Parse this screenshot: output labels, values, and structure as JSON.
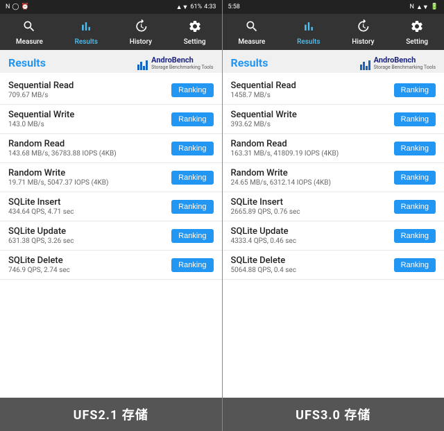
{
  "left_phone": {
    "status_bar": {
      "left": "N  ◯  ⏰",
      "signal": "▲▼",
      "battery": "61%",
      "time": "4:33"
    },
    "nav": {
      "items": [
        {
          "id": "measure",
          "label": "Measure",
          "icon": "search"
        },
        {
          "id": "results",
          "label": "Results",
          "icon": "chart",
          "active": true
        },
        {
          "id": "history",
          "label": "History",
          "icon": "history"
        },
        {
          "id": "setting",
          "label": "Setting",
          "icon": "settings"
        }
      ]
    },
    "results_title": "Results",
    "brand_name": "AndroBench",
    "brand_sub": "Storage Benchmarking Tools",
    "benchmarks": [
      {
        "name": "Sequential Read",
        "value": "709.67 MB/s"
      },
      {
        "name": "Sequential Write",
        "value": "143.0 MB/s"
      },
      {
        "name": "Random Read",
        "value": "143.68 MB/s, 36783.88 IOPS (4KB)"
      },
      {
        "name": "Random Write",
        "value": "19.71 MB/s, 5047.37 IOPS (4KB)"
      },
      {
        "name": "SQLite Insert",
        "value": "434.64 QPS, 4.71 sec"
      },
      {
        "name": "SQLite Update",
        "value": "631.38 QPS, 3.26 sec"
      },
      {
        "name": "SQLite Delete",
        "value": "746.9 QPS, 2.74 sec"
      }
    ],
    "ranking_label": "Ranking",
    "bottom_label": "UFS2.1 存储"
  },
  "right_phone": {
    "status_bar": {
      "left": "5:58",
      "icons": "N  ▼",
      "battery": ""
    },
    "nav": {
      "items": [
        {
          "id": "measure",
          "label": "Measure",
          "icon": "search"
        },
        {
          "id": "results",
          "label": "Results",
          "icon": "chart",
          "active": true
        },
        {
          "id": "history",
          "label": "History",
          "icon": "history"
        },
        {
          "id": "setting",
          "label": "Setting",
          "icon": "settings"
        }
      ]
    },
    "results_title": "Results",
    "brand_name": "AndroBench",
    "brand_sub": "Storage Benchmarking Tools",
    "benchmarks": [
      {
        "name": "Sequential Read",
        "value": "1458.7 MB/s"
      },
      {
        "name": "Sequential Write",
        "value": "393.62 MB/s"
      },
      {
        "name": "Random Read",
        "value": "163.31 MB/s, 41809.19 IOPS (4KB)"
      },
      {
        "name": "Random Write",
        "value": "24.65 MB/s, 6312.14 IOPS (4KB)"
      },
      {
        "name": "SQLite Insert",
        "value": "2665.89 QPS, 0.76 sec"
      },
      {
        "name": "SQLite Update",
        "value": "4333.4 QPS, 0.46 sec"
      },
      {
        "name": "SQLite Delete",
        "value": "5064.88 QPS, 0.4 sec"
      }
    ],
    "ranking_label": "Ranking",
    "bottom_label": "UFS3.0 存储"
  }
}
